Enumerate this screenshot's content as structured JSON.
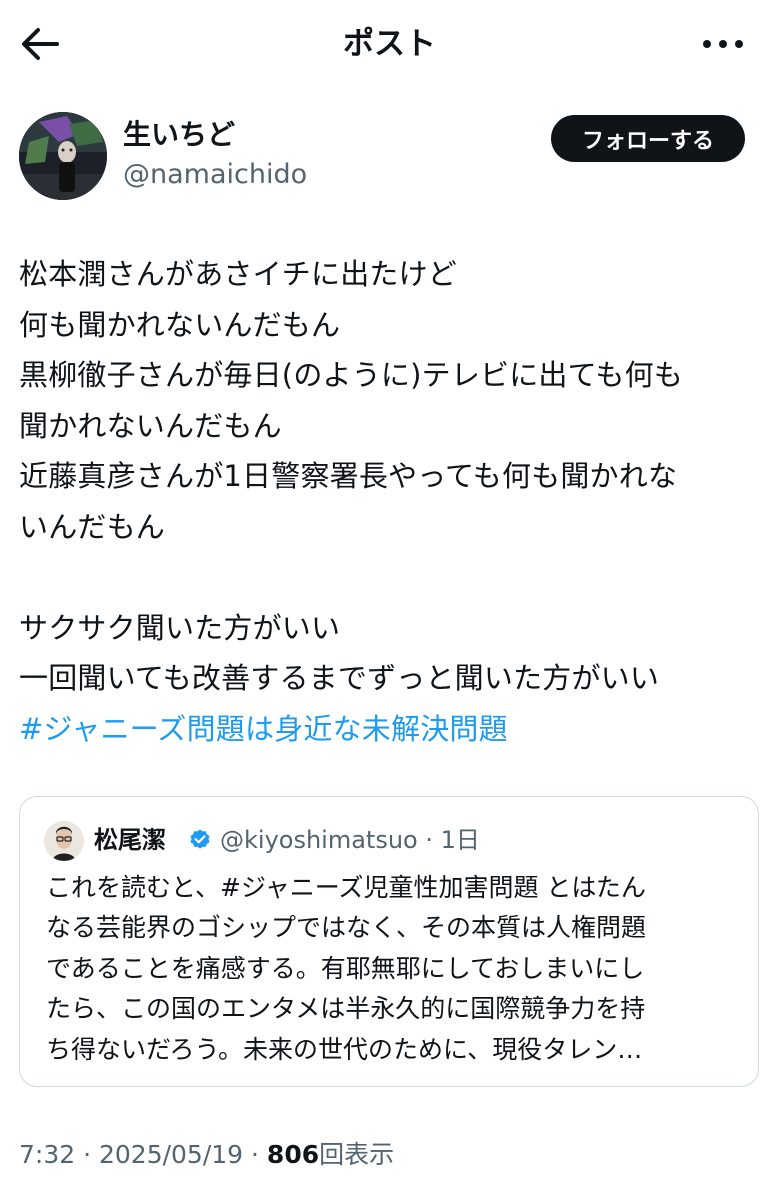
{
  "header": {
    "title": "ポスト",
    "back_icon": "arrow-left-icon",
    "more_icon": "more-horizontal-icon"
  },
  "author": {
    "name": "生いちど",
    "handle": "@namaichido",
    "follow_label": "フォローする"
  },
  "post": {
    "lines": [
      "松本潤さんがあさイチに出たけど",
      "何も聞かれないんだもん",
      "黒柳徹子さんが毎日(のように)テレビに出ても何も",
      "聞かれないんだもん",
      "近藤真彦さんが1日警察署長やっても何も聞かれな",
      "いんだもん",
      "",
      "サクサク聞いた方がいい",
      "一回聞いても改善するまでずっと聞いた方がいい"
    ],
    "hashtag": "#ジャニーズ問題は身近な未解決問題"
  },
  "quote": {
    "name": "松尾潔",
    "verified": true,
    "handle_time": "@kiyoshimatsuo · 1日",
    "lines": [
      "これを読むと、#ジャニーズ児童性加害問題 とはたん",
      "なる芸能界のゴシップではなく、その本質は人権問題",
      "であることを痛感する。有耶無耶にしておしまいにし",
      "たら、この国のエンタメは半永久的に国際競争力を持",
      "ち得ないだろう。未来の世代のために、現役タレン…"
    ]
  },
  "meta": {
    "time_date": "7:32 · 2025/05/19 · ",
    "views_count": "806",
    "views_label": "回表示"
  },
  "colors": {
    "link": "#1d9bf0",
    "text": "#0f1419",
    "secondary": "#536471",
    "border": "#cfd9de",
    "follow_bg": "#0f1419"
  }
}
